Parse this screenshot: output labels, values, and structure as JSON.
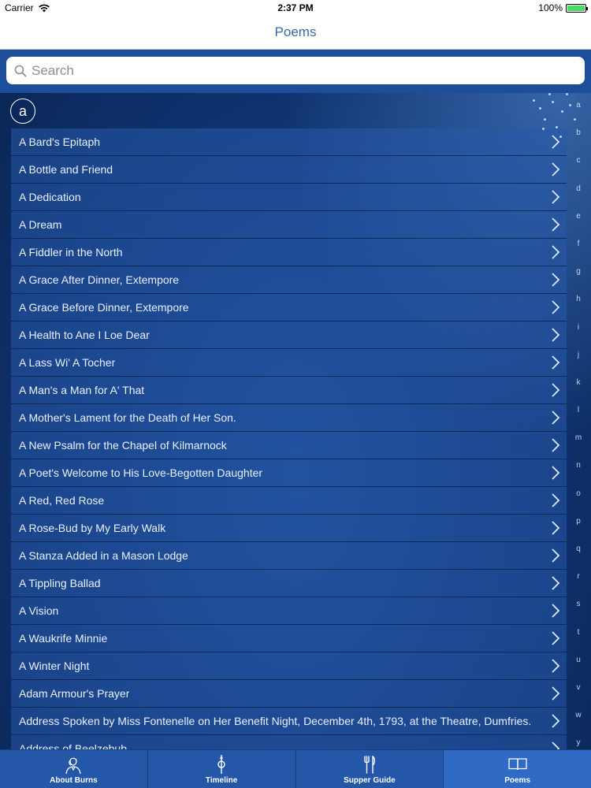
{
  "status_bar": {
    "carrier": "Carrier",
    "time": "2:37 PM",
    "battery": "100%"
  },
  "nav": {
    "title": "Poems"
  },
  "search": {
    "placeholder": "Search"
  },
  "section": {
    "letter": "a"
  },
  "poems": [
    "A Bard's Epitaph",
    "A Bottle and Friend",
    "A Dedication",
    "A Dream",
    "A Fiddler in the North",
    "A Grace After Dinner, Extempore",
    "A Grace Before Dinner, Extempore",
    "A Health to Ane I Loe Dear",
    "A Lass Wi' A Tocher",
    "A Man's a Man for A' That",
    "A Mother's Lament for the Death of Her Son.",
    "A New Psalm for the Chapel of Kilmarnock",
    "A Poet's Welcome to His Love-Begotten Daughter",
    "A Red, Red Rose",
    "A Rose-Bud by My Early Walk",
    "A Stanza Added in a Mason Lodge",
    "A Tippling Ballad",
    "A Vision",
    "A Waukrife Minnie",
    "A Winter Night",
    "Adam Armour's Prayer",
    "Address Spoken by Miss Fontenelle on Her Benefit Night, December 4th, 1793, at the Theatre, Dumfries.",
    "Address of Beelzebub"
  ],
  "index_letters": [
    "a",
    "b",
    "c",
    "d",
    "e",
    "f",
    "g",
    "h",
    "i",
    "j",
    "k",
    "l",
    "m",
    "n",
    "o",
    "p",
    "q",
    "r",
    "s",
    "t",
    "u",
    "v",
    "w",
    "y"
  ],
  "tabs": [
    {
      "label": "About Burns",
      "icon": "burns-portrait-icon",
      "active": false
    },
    {
      "label": "Timeline",
      "icon": "timeline-icon",
      "active": false
    },
    {
      "label": "Supper Guide",
      "icon": "fork-knife-icon",
      "active": false
    },
    {
      "label": "Poems",
      "icon": "book-icon",
      "active": true
    }
  ],
  "colors": {
    "accent": "#3a6aa6",
    "background": "#0f336f",
    "tab_bar": "#2457a8",
    "battery_fill": "#4cd964"
  }
}
